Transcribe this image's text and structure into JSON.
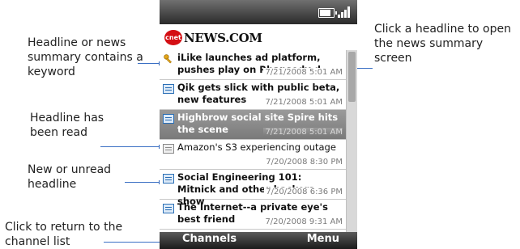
{
  "callouts": {
    "keyword": "Headline or news summary contains a keyword",
    "read": "Headline has been read",
    "unread": "New or unread headline",
    "channel_list": "Click to return to the channel list",
    "open_summary": "Click a headline to open the news summary screen"
  },
  "header": {
    "logo_badge": "cnet",
    "logo_text": "NEWS.COM"
  },
  "status": {
    "battery_icon": "battery-icon",
    "signal_icon": "signal-icon"
  },
  "headlines": [
    {
      "title": "iLike launches ad platform, pushes play on Rhapsody d",
      "date": "7/21/2008 5:01 AM",
      "state": "keyword"
    },
    {
      "title": "Qik gets slick with public beta, new features",
      "date": "7/21/2008 5:01 AM",
      "state": "unread"
    },
    {
      "title": "Highbrow social site Spire hits the scene",
      "date": "7/21/2008 5:01 AM",
      "state": "selected"
    },
    {
      "title": "Amazon's S3 experiencing outage",
      "date": "7/20/2008 8:30 PM",
      "state": "read"
    },
    {
      "title": "Social Engineering 101: Mitnick and other hackers show",
      "date": "7/20/2008 6:36 PM",
      "state": "unread"
    },
    {
      "title": "The Internet--a private eye's best friend",
      "date": "7/20/2008 9:31 AM",
      "state": "unread"
    }
  ],
  "softkeys": {
    "left": "Channels",
    "right": "Menu"
  },
  "colors": {
    "accent": "#3a6fc4",
    "logo_red": "#d40f14",
    "unread_icon": "#2b6fb6"
  }
}
